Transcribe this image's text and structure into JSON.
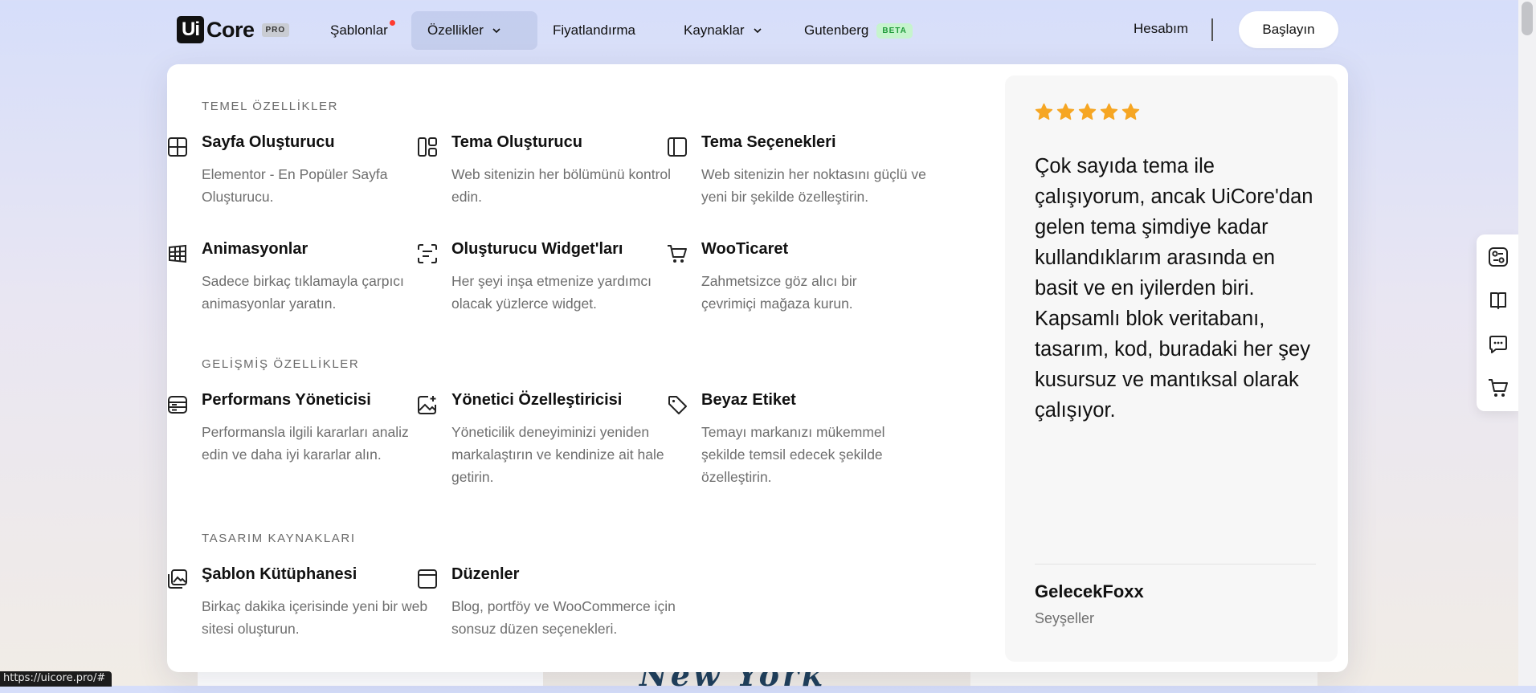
{
  "nav": {
    "logo_ui": "Ui",
    "logo_core": "Core",
    "logo_pro": "PRO",
    "templates": "Şablonlar",
    "features": "Özellikler",
    "pricing": "Fiyatlandırma",
    "resources": "Kaynaklar",
    "gutenberg": "Gutenberg",
    "beta": "BETA",
    "account": "Hesabım",
    "start": "Başlayın"
  },
  "sections": {
    "core": "TEMEL ÖZELLİKLER",
    "advanced": "GELİŞMİŞ ÖZELLİKLER",
    "design": "TASARIM KAYNAKLARI"
  },
  "features": {
    "page_builder": {
      "title": "Sayfa Oluşturucu",
      "desc": "Elementor - En Popüler Sayfa Oluşturucu.",
      "icon": "layout-grid-icon"
    },
    "theme_builder": {
      "title": "Tema Oluşturucu",
      "desc": "Web sitenizin her bölümünü kontrol edin.",
      "icon": "theme-builder-icon"
    },
    "theme_options": {
      "title": "Tema Seçenekleri",
      "desc": "Web sitenizin her noktasını güçlü ve yeni bir şekilde özelleştirin.",
      "icon": "sidebar-panel-icon"
    },
    "animations": {
      "title": "Animasyonlar",
      "desc": "Sadece birkaç tıklamayla çarpıcı animasyonlar yaratın.",
      "icon": "animation-grid-icon"
    },
    "widgets": {
      "title": "Oluşturucu Widget'ları",
      "desc": "Her şeyi inşa etmenize yardımcı olacak yüzlerce widget.",
      "icon": "widget-icon"
    },
    "woocommerce": {
      "title": "WooTicaret",
      "desc": "Zahmetsizce göz alıcı bir çevrimiçi mağaza kurun.",
      "icon": "cart-icon"
    },
    "performance": {
      "title": "Performans Yöneticisi",
      "desc": "Performansla ilgili kararları analiz edin ve daha iyi kararlar alın.",
      "icon": "server-icon"
    },
    "admin": {
      "title": "Yönetici Özelleştiricisi",
      "desc": "Yöneticilik deneyiminizi yeniden markalaştırın ve kendinize ait hale getirin.",
      "icon": "image-plus-icon"
    },
    "white_label": {
      "title": "Beyaz Etiket",
      "desc": "Temayı markanızı mükemmel şekilde temsil edecek şekilde özelleştirin.",
      "icon": "tag-icon"
    },
    "template_library": {
      "title": "Şablon Kütüphanesi",
      "desc": "Birkaç dakika içerisinde yeni bir web sitesi oluşturun.",
      "icon": "gallery-icon"
    },
    "layouts": {
      "title": "Düzenler",
      "desc": "Blog, portföy ve WooCommerce için sonsuz düzen seçenekleri.",
      "icon": "layout-icon"
    }
  },
  "review": {
    "stars": 5,
    "star_color": "#f6a623",
    "quote": "Çok sayıda tema ile çalışıyorum, ancak UiCore'dan gelen tema şimdiye kadar kullandıklarım arasında en basit ve en iyilerden biri. Kapsamlı blok veritabanı, tasarım, kod, buradaki her şey kusursuz ve mantıksal olarak çalışıyor.",
    "author": "GelecekFoxx",
    "location": "Seyşeller"
  },
  "sidebar": {
    "icons": [
      "settings-sliders-icon",
      "book-icon",
      "chat-icon",
      "cart-icon"
    ]
  },
  "background": {
    "peek_text": "New York"
  },
  "status_url": "https://uicore.pro/#"
}
